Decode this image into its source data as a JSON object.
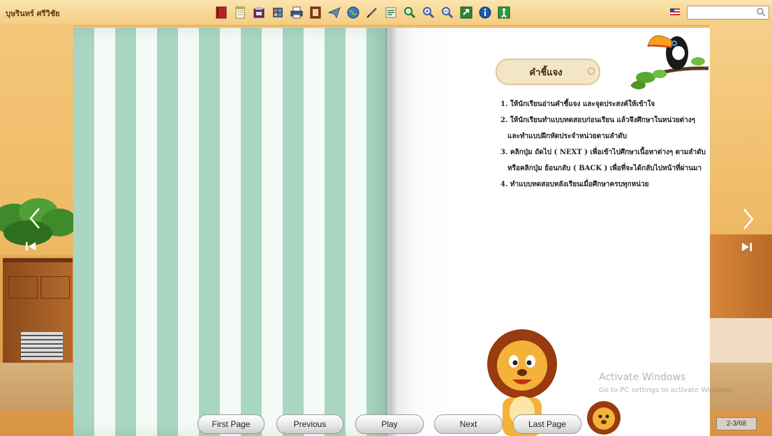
{
  "header": {
    "author_name": "บุษรินทร์  ศรีวิชัย",
    "toolbar_icons": [
      "book-icon",
      "note-icon",
      "shop-icon",
      "bookmark-icon",
      "print-icon",
      "table-of-contents-icon",
      "send-icon",
      "globe-icon",
      "pen-icon",
      "text-icon",
      "search-icon",
      "zoom-in-icon",
      "zoom-out-icon",
      "fullscreen-icon",
      "info-icon",
      "exit-icon"
    ],
    "search": {
      "placeholder": "",
      "value": ""
    },
    "language_icon": "us-flag-icon"
  },
  "page": {
    "title": "คำชี้แจง",
    "instructions": [
      "1. ให้นักเรียนอ่านคำชี้แจง และจุดประสงค์ให้เข้าใจ",
      "2. ให้นักเรียนทำแบบทดสอบก่อนเรียน แล้วจึงศึกษาในหน่วยต่างๆ",
      "และทำแบบฝึกหัดประจำหน่วยตามลำดับ",
      "3. คลิกปุ่ม  ถัดไป ( NEXT ) เพื่อเข้าไปศึกษาเนื้อหาต่างๆ ตามลำดับ",
      "หรือคลิกปุ่ม ย้อนกลับ ( BACK )  เพื่อที่จะได้กลับไปหน้าที่ผ่านมา",
      "4. ทำแบบทดสอบหลังเรียนเมื่อศึกษาครบทุกหน่วย"
    ]
  },
  "nav": {
    "first_page": "First Page",
    "previous": "Previous",
    "play": "Play",
    "next": "Next",
    "last_page": "Last Page",
    "page_indicator": "2-3/68"
  },
  "watermark": {
    "title": "Activate Windows",
    "subtitle": "Go to PC settings to activate Windows."
  },
  "colors": {
    "stripe_green": "#a9d6c3",
    "stripe_white": "#f4fbf6",
    "toolbar_bg": "#f4cc80",
    "room_bg": "#e9ae57"
  }
}
